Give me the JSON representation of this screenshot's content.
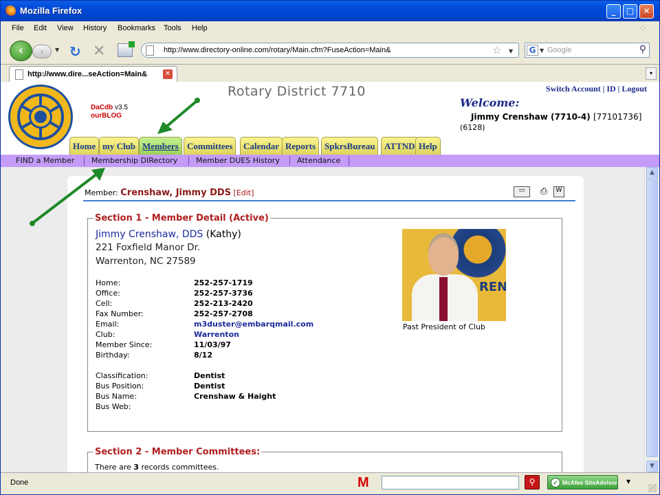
{
  "window": {
    "title": "Mozilla Firefox"
  },
  "menu": [
    "File",
    "Edit",
    "View",
    "History",
    "Bookmarks",
    "Tools",
    "Help"
  ],
  "toolbar": {
    "url": "http://www.directory-online.com/rotary/Main.cfm?FuseAction=Main&",
    "search_placeholder": "Google"
  },
  "tab": {
    "title": "http://www.dire...seAction=Main&"
  },
  "header": {
    "brand_name": "DaCdb",
    "brand_version": "v3.5",
    "blog": "ourBLOG",
    "district": "Rotary District 7710",
    "account_links": "Switch Account | ID | Logout",
    "welcome": "Welcome:",
    "user_name": "Jimmy Crenshaw (7710-4)",
    "user_id": "[77101736]",
    "user_code": "(6128)"
  },
  "main_nav": [
    "Home",
    "my Club",
    "Members",
    "Committees",
    "Calendar",
    "Reports",
    "SpkrsBureau",
    "ATTND",
    "Help"
  ],
  "main_nav_active": "Members",
  "sub_nav": [
    "FIND a Member",
    "Membership DIRectory",
    "Member DUES History",
    "Attendance"
  ],
  "member": {
    "label": "Member:",
    "name": "Crenshaw, Jimmy DDS",
    "edit": "[Edit]"
  },
  "section1": {
    "title": "Section 1 - Member Detail (Active)",
    "full_name": "Jimmy Crenshaw, DDS",
    "spouse": "(Kathy)",
    "address1": "221 Foxfield Manor Dr.",
    "address2": "Warrenton, NC  27589",
    "photo_caption": "Past President of Club",
    "contact": [
      {
        "label": "Home:",
        "value": "252-257-1719"
      },
      {
        "label": "Office:",
        "value": "252-257-3736"
      },
      {
        "label": "Cell:",
        "value": "252-213-2420"
      },
      {
        "label": "Fax Number:",
        "value": "252-257-2708"
      },
      {
        "label": "Email:",
        "value": "m3duster@embarqmail.com"
      },
      {
        "label": "Club:",
        "value": "Warrenton"
      },
      {
        "label": "Member Since:",
        "value": "11/03/97"
      },
      {
        "label": "Birthday:",
        "value": "8/12"
      }
    ],
    "business": [
      {
        "label": "Classification:",
        "value": "Dentist"
      },
      {
        "label": "Bus Position:",
        "value": "Dentist"
      },
      {
        "label": "Bus Name:",
        "value": "Crenshaw & Haight"
      },
      {
        "label": "Bus Web:",
        "value": ""
      }
    ]
  },
  "section2": {
    "title": "Section 2 - Member Committees:",
    "text_before": "There are",
    "count": "3",
    "text_after": "records committees."
  },
  "statusbar": {
    "status": "Done",
    "siteadvisor": "McAfee SiteAdvisor"
  },
  "colors": {
    "titlebar": "#0148d8",
    "nav_tab": "#fbf48f",
    "subnav": "#c49cf8",
    "section_title": "#b01e1e",
    "link_blue": "#1a2a9a",
    "arrow": "#1f8a2a"
  }
}
